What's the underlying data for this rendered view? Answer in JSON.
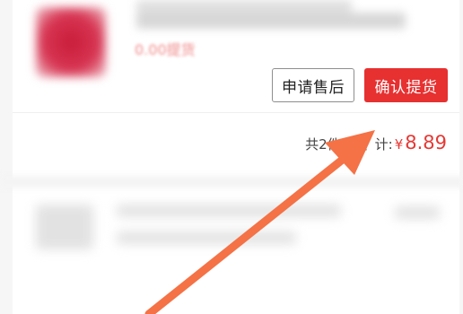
{
  "order": {
    "price_fragment": "0.00提货",
    "actions": {
      "after_sale_label": "申请售后",
      "confirm_pickup_label": "确认提货"
    },
    "summary": {
      "item_count_label": "共2件商品",
      "total_label": "计:",
      "currency": "¥",
      "total_amount": "8.89"
    }
  },
  "colors": {
    "accent_red": "#e73030",
    "price_red": "#e53935",
    "arrow": "#f47246"
  },
  "icons": {
    "overlay": "pointer-arrow-icon"
  }
}
